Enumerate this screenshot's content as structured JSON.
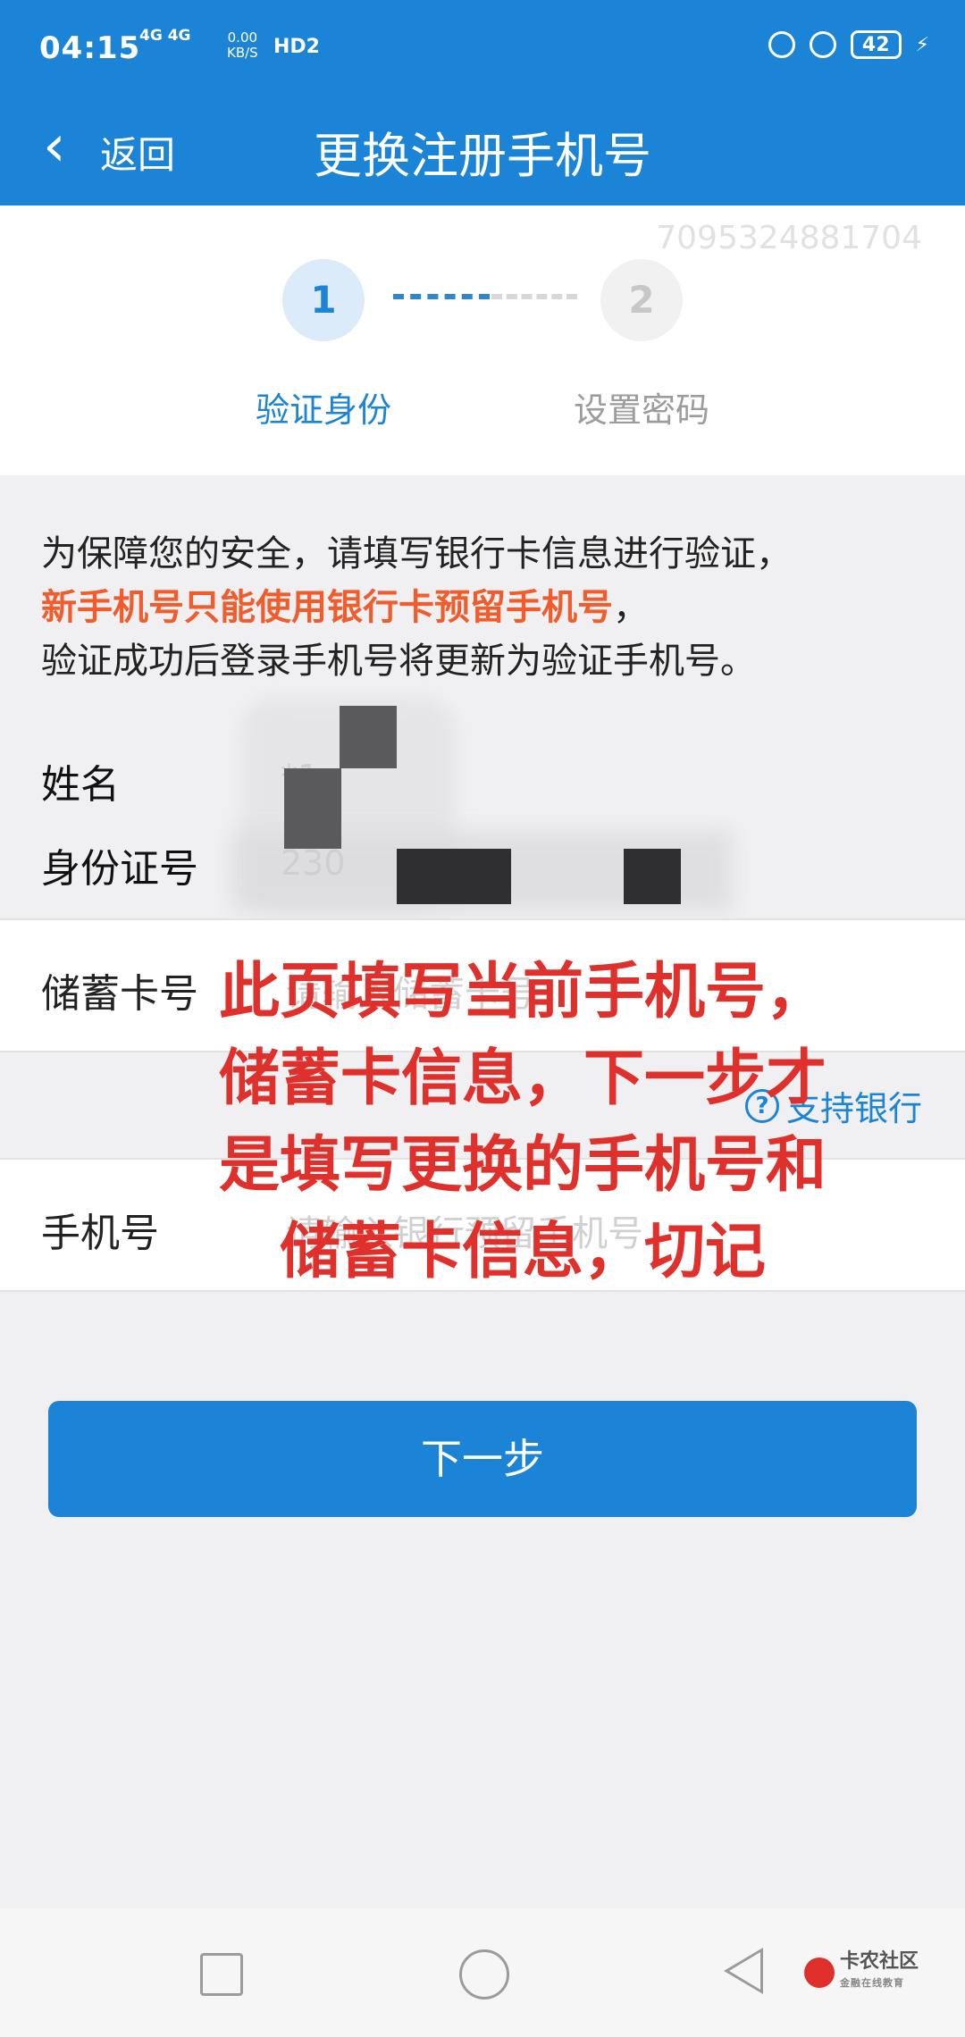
{
  "status_bar": {
    "time": "04:15",
    "network": "4G 4G",
    "speed_value": "0.00",
    "speed_unit": "KB/S",
    "hd": "HD2",
    "battery": "42"
  },
  "nav": {
    "back_label": "返回",
    "title": "更换注册手机号"
  },
  "steps": {
    "watermark": "7095324881704",
    "items": [
      {
        "number": "1",
        "label": "验证身份",
        "active": true
      },
      {
        "number": "2",
        "label": "设置密码",
        "active": false
      }
    ]
  },
  "info": {
    "line1": "为保障您的安全，请填写银行卡信息进行验证，",
    "line2_highlight": "新手机号只能使用银行卡预留手机号",
    "line2_tail": "，",
    "line3": "验证成功后登录手机号将更新为验证手机号。"
  },
  "identity": {
    "name_label": "姓名",
    "name_value": "*1",
    "id_label": "身份证号",
    "id_value": "230"
  },
  "form": {
    "card_label": "储蓄卡号",
    "card_placeholder": "请输入储蓄卡号",
    "support_banks": "支持银行",
    "phone_label": "手机号",
    "phone_placeholder": "请输入银行预留手机号"
  },
  "overlay_note": {
    "lines": [
      "此页填写当前手机号，",
      "储蓄卡信息，下一步才",
      "是填写更换的手机号和",
      "储蓄卡信息，切记"
    ]
  },
  "button": {
    "next": "下一步"
  },
  "branding": {
    "logo_text": "卡农社区",
    "logo_sub": "金融在线教育"
  },
  "colors": {
    "primary": "#1b84d6",
    "warning": "#f05c2b",
    "overlay_red": "#e0302c",
    "background": "#f0f0f2"
  }
}
